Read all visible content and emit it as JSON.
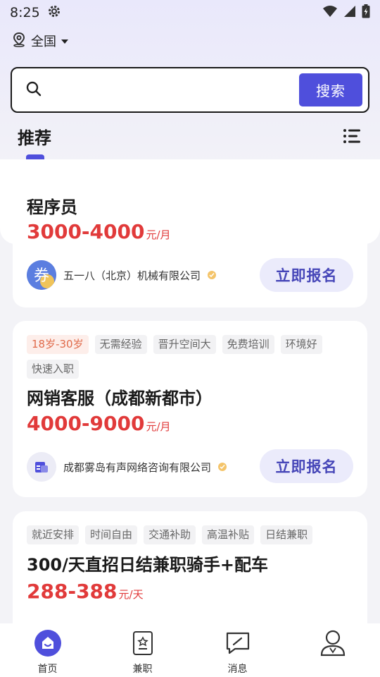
{
  "status_bar": {
    "time": "8:25"
  },
  "location": {
    "label": "全国"
  },
  "search": {
    "placeholder": "",
    "button_label": "搜索"
  },
  "section": {
    "title": "推荐"
  },
  "jobs": [
    {
      "tags": [],
      "title": "程序员",
      "salary": "3000-4000",
      "salary_unit": "元/月",
      "company": "五一八（北京）机械有限公司",
      "apply_label": "立即报名"
    },
    {
      "tags": [
        "18岁-30岁",
        "无需经验",
        "晋升空间大",
        "免费培训",
        "环境好",
        "快速入职"
      ],
      "title": "网销客服（成都新都市）",
      "salary": "4000-9000",
      "salary_unit": "元/月",
      "company": "成都雾岛有声网络咨询有限公司",
      "apply_label": "立即报名"
    },
    {
      "tags": [
        "就近安排",
        "时间自由",
        "交通补助",
        "高温补贴",
        "日结兼职"
      ],
      "title": "300/天直招日结兼职骑手+配车",
      "salary": "288-388",
      "salary_unit": "元/天",
      "company": "",
      "apply_label": ""
    }
  ],
  "nav": [
    {
      "label": "首页",
      "icon": "home-icon"
    },
    {
      "label": "兼职",
      "icon": "part-time-icon"
    },
    {
      "label": "消息",
      "icon": "message-icon"
    },
    {
      "label": "",
      "icon": "profile-icon"
    }
  ],
  "colors": {
    "accent": "#4f4fdc",
    "salary": "#e13a3a",
    "tag_age": "#e06a4a"
  }
}
